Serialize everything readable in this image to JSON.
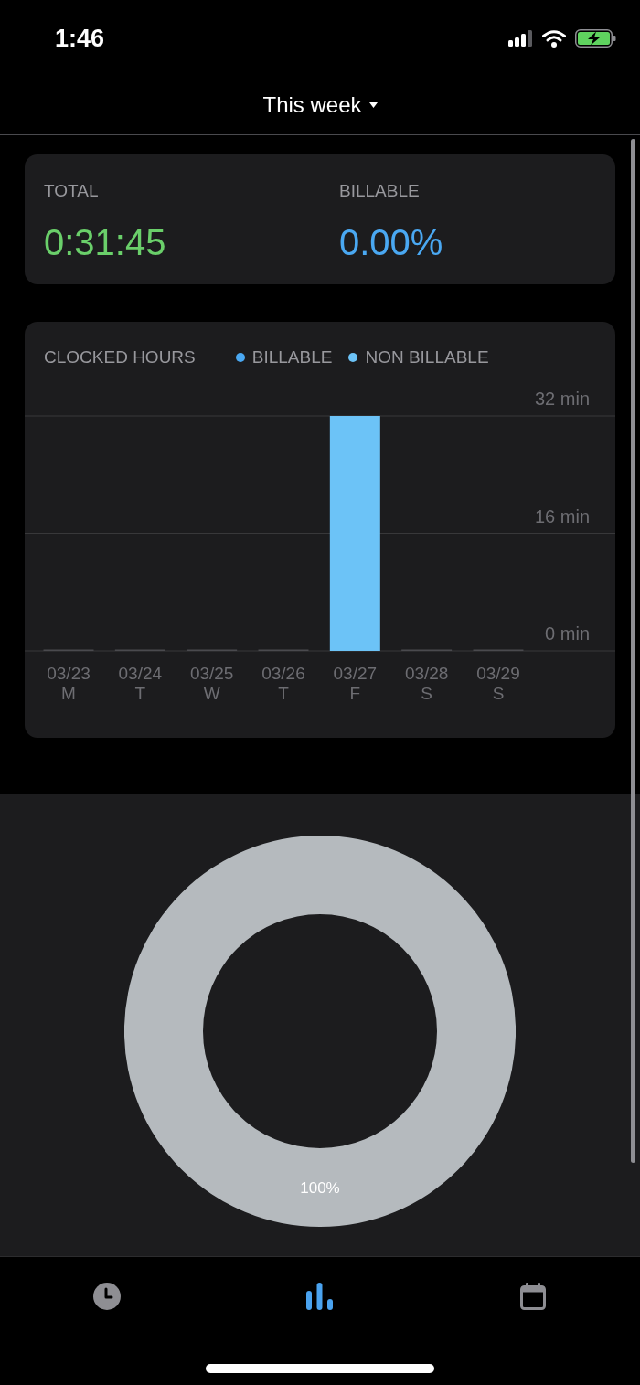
{
  "status_bar": {
    "time": "1:46"
  },
  "header": {
    "title": "This week"
  },
  "summary": {
    "items": [
      {
        "label": "TOTAL",
        "value": "0:31:45",
        "color": "#6acf6a"
      },
      {
        "label": "BILLABLE",
        "value": "0.00%",
        "color": "#4aa8f2"
      }
    ]
  },
  "clocked_hours": {
    "title": "CLOCKED HOURS",
    "weekdays": [
      "M",
      "T",
      "W",
      "T",
      "F",
      "S",
      "S"
    ],
    "chart_data": {
      "type": "bar",
      "stacked": true,
      "categories": [
        "03/23",
        "03/24",
        "03/25",
        "03/26",
        "03/27",
        "03/28",
        "03/29"
      ],
      "series": [
        {
          "name": "BILLABLE",
          "color": "#4aa8f2",
          "values": [
            0,
            0,
            0,
            0,
            0,
            0,
            0
          ]
        },
        {
          "name": "NON BILLABLE",
          "color": "#6cc3f7",
          "values": [
            0,
            0,
            0,
            0,
            32,
            0,
            0
          ]
        }
      ],
      "ylim": [
        0,
        32
      ],
      "yticks": [
        {
          "value": 0,
          "label": "0 min"
        },
        {
          "value": 16,
          "label": "16 min"
        },
        {
          "value": 32,
          "label": "32 min"
        }
      ]
    }
  },
  "breakdown": {
    "chart_data": {
      "type": "donut",
      "series": [
        {
          "color": "#b5babe",
          "values": [
            100
          ]
        }
      ],
      "value_labels": [
        "100%"
      ]
    }
  },
  "tab_bar": {
    "tabs": [
      {
        "kind": "clock",
        "selected": false
      },
      {
        "kind": "chart",
        "selected": true
      },
      {
        "kind": "calendar",
        "selected": false
      }
    ]
  }
}
